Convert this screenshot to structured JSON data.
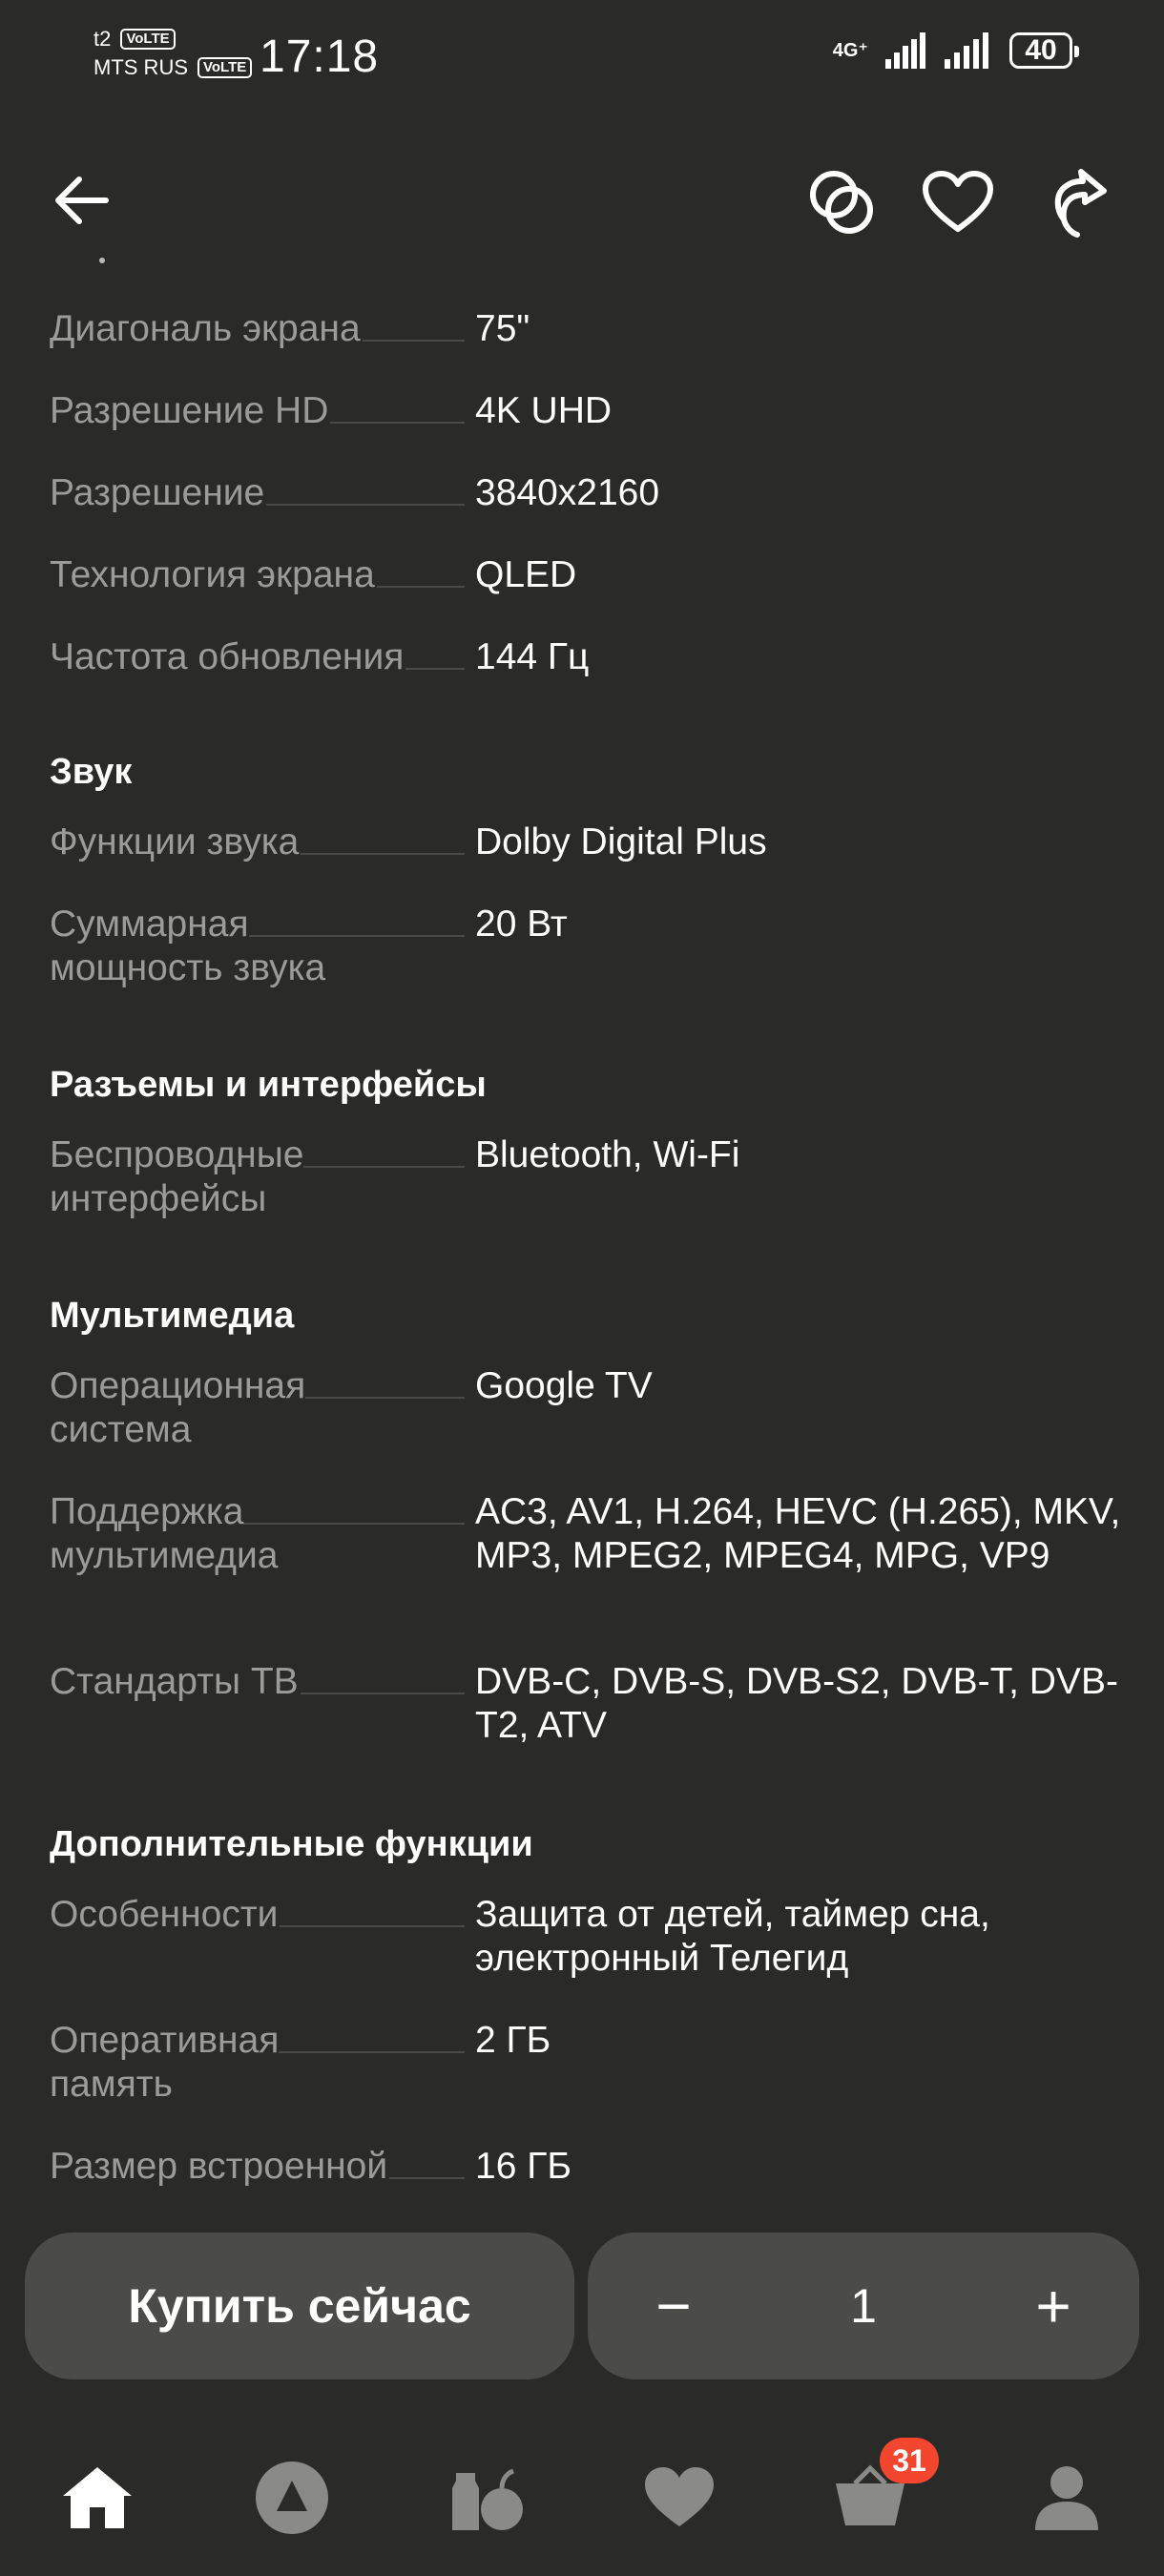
{
  "status_bar": {
    "carrier1": "t2",
    "carrier2": "MTS RUS",
    "volte": "VoLTE",
    "time": "17:18",
    "network": "4G⁺",
    "battery": "40"
  },
  "appbar": {
    "back_icon": "arrow-left-icon",
    "compare_icon": "compare-circles-icon",
    "favorite_icon": "heart-outline-icon",
    "share_icon": "share-arrow-icon"
  },
  "specs": {
    "rows_display": [
      {
        "name": "Диагональ экрана",
        "value": "75\""
      },
      {
        "name": "Разрешение HD",
        "value": "4K UHD"
      },
      {
        "name": "Разрешение",
        "value": "3840x2160"
      },
      {
        "name": "Технология экрана",
        "value": "QLED"
      },
      {
        "name": "Частота обновления",
        "value": "144 Гц"
      }
    ],
    "sound_title": "Звук",
    "sound": [
      {
        "name": "Функции звука",
        "value": "Dolby Digital Plus"
      },
      {
        "name": "Суммарная мощность звука",
        "value": "20 Вт"
      }
    ],
    "ports_title": "Разъемы и интерфейсы",
    "ports": [
      {
        "name": "Беспроводные интерфейсы",
        "value": "Bluetooth, Wi-Fi"
      }
    ],
    "multimedia_title": "Мультимедиа",
    "multimedia": [
      {
        "name": "Операционная система",
        "value": "Google TV"
      },
      {
        "name": "Поддержка мультимедиа",
        "value": "AC3, AV1, H.264, HEVC (H.265), MKV, MP3, MPEG2, MPEG4, MPG, VP9"
      },
      {
        "name": "Стандарты ТВ",
        "value": "DVB-C, DVB-S, DVB-S2, DVB-T, DVB-T2, ATV"
      }
    ],
    "extra_title": "Дополнительные функции",
    "extra": [
      {
        "name": "Особенности",
        "value": "Защита от детей, таймер сна, электронный Телегид"
      },
      {
        "name": "Оперативная память",
        "value": "2 ГБ"
      },
      {
        "name": "Размер встроенной",
        "value": "16 ГБ"
      }
    ]
  },
  "buy": {
    "buy_now_label": "Купить сейчас",
    "minus": "−",
    "quantity": "1",
    "plus": "+"
  },
  "bottom_nav": {
    "items": [
      "home-icon",
      "alice-icon",
      "grocery-icon",
      "heart-icon",
      "cart-icon",
      "profile-icon"
    ],
    "cart_badge": "31"
  }
}
